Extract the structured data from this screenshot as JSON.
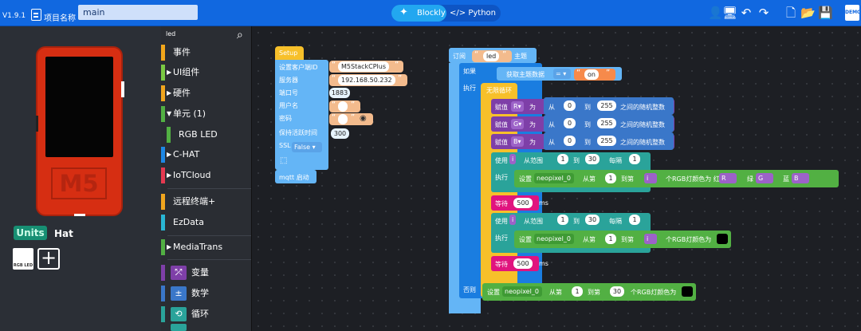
{
  "header": {
    "version": "V1.9.1",
    "project_label": "项目名称",
    "project_name": "main",
    "mode_blockly": "Blockly",
    "mode_python": "Python",
    "demo": "DEMO"
  },
  "left": {
    "device_logo": "M5",
    "units_tab": "Units",
    "hat_tab": "Hat",
    "unit_tile": "RGB LED"
  },
  "toolbox": {
    "search_text": "led",
    "categories": [
      {
        "label": "事件",
        "color": "#f2a61b"
      },
      {
        "label": "UI组件",
        "color": "#7ac943"
      },
      {
        "label": "硬件",
        "color": "#f0a51e"
      },
      {
        "label": "单元 (1)",
        "color": "#52b043"
      },
      {
        "label": "RGB LED",
        "color": "#52b043"
      },
      {
        "label": "C-HAT",
        "color": "#1e88e5"
      },
      {
        "label": "IoTCloud",
        "color": "#e53950"
      },
      {
        "label": "远程终端+",
        "color": "#f0a51e"
      },
      {
        "label": "EzData",
        "color": "#29b6d4"
      },
      {
        "label": "MediaTrans",
        "color": "#52b043"
      },
      {
        "label": "变量",
        "color": "#7e3fa8"
      },
      {
        "label": "数学",
        "color": "#3a77c9"
      },
      {
        "label": "循环",
        "color": "#2aa39a"
      }
    ]
  },
  "setup": {
    "title": "Setup",
    "client_id_label": "设置客户端ID",
    "client_id": "M5StackCPlus",
    "server_label": "服务器",
    "server": "192.168.50.232",
    "port_label": "端口号",
    "port": "1883",
    "user_label": "用户名",
    "user": "",
    "password_label": "密码",
    "password": "",
    "keepalive_label": "保持活跃时间",
    "keepalive": "300",
    "ssl_label": "SSL",
    "ssl": "False",
    "start": "mqtt 启动"
  },
  "subscribe": {
    "title": "订阅",
    "topic": "led",
    "topic_suffix": "主题",
    "if": "如果",
    "get_data": "获取主题数据",
    "op": "=",
    "value": "on",
    "do": "执行",
    "loop": "无限循环",
    "assign": "赋值",
    "var_r": "R",
    "var_g": "G",
    "var_b": "B",
    "as": "为",
    "from": "从",
    "zero": "0",
    "to": "到",
    "max": "255",
    "rand": "之间的随机整数",
    "use": "使用",
    "var_i": "i",
    "range_from": "从范围",
    "one": "1",
    "thirty": "30",
    "step": "每隔",
    "do2": "执行",
    "set": "设置",
    "neopixel": "neopixel_0",
    "from2": "从第",
    "to2": "到第",
    "rgb_color": "个RGB灯颜色为 红",
    "green": "绿",
    "blue": "蓝",
    "wait": "等待",
    "ms_val": "500",
    "ms": "ms",
    "rgb_color2": "个RGB灯颜色为",
    "else": "否则"
  }
}
